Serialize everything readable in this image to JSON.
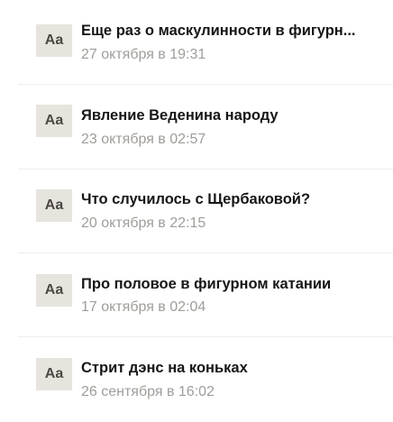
{
  "posts": [
    {
      "thumb": "Aa",
      "title": "Еще раз о маскулинности в фигурн...",
      "date": "27 октября в 19:31"
    },
    {
      "thumb": "Aa",
      "title": "Явление Веденина народу",
      "date": "23 октября в 02:57"
    },
    {
      "thumb": "Aa",
      "title": "Что случилось с Щербаковой?",
      "date": "20 октября в 22:15"
    },
    {
      "thumb": "Aa",
      "title": "Про половое в фигурном катании",
      "date": "17 октября в 02:04"
    },
    {
      "thumb": "Aa",
      "title": "Стрит дэнс на коньках",
      "date": "26 сентября в 16:02"
    }
  ]
}
